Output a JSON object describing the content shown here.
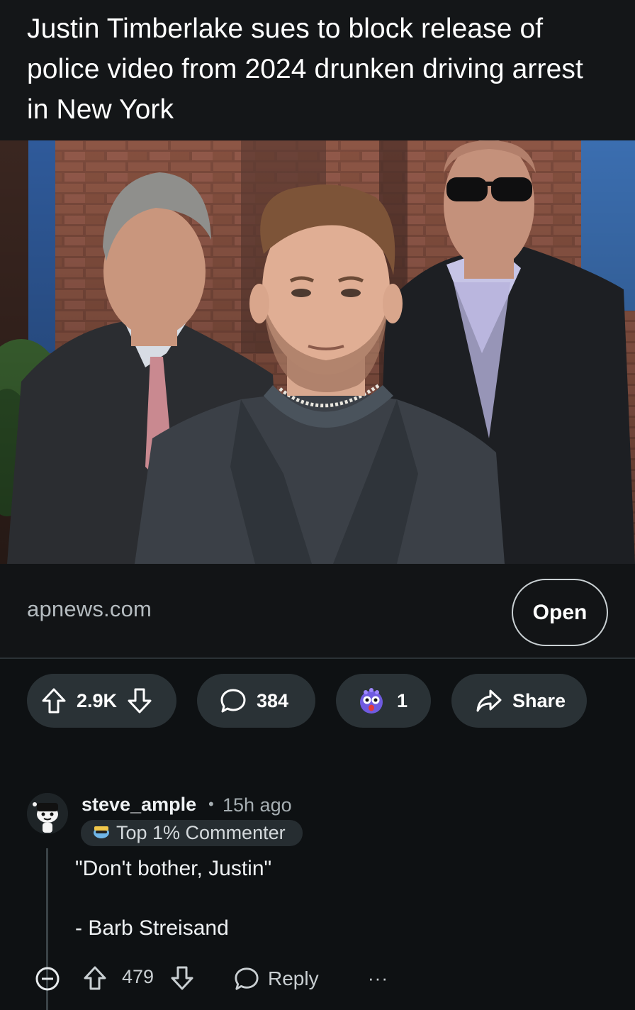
{
  "post": {
    "title": "Justin Timberlake sues to block release of police video from 2024 drunken driving arrest in New York",
    "image_icon": "news-photo",
    "link": {
      "domain": "apnews.com",
      "open_label": "Open"
    }
  },
  "actions": {
    "votes": "2.9K",
    "comments": "384",
    "awards": "1",
    "share_label": "Share"
  },
  "comment": {
    "username": "steve_ample",
    "separator": "•",
    "time": "15h ago",
    "badge": "Top 1% Commenter",
    "lines": [
      "\"Don't bother, Justin\"",
      "- Barb Streisand"
    ],
    "votes": "479",
    "reply_label": "Reply",
    "more_label": "···"
  },
  "colors": {
    "background": "#0e1113",
    "pill": "#2a3236",
    "text": "#f2f4f5",
    "muted": "#a6aeb2"
  }
}
